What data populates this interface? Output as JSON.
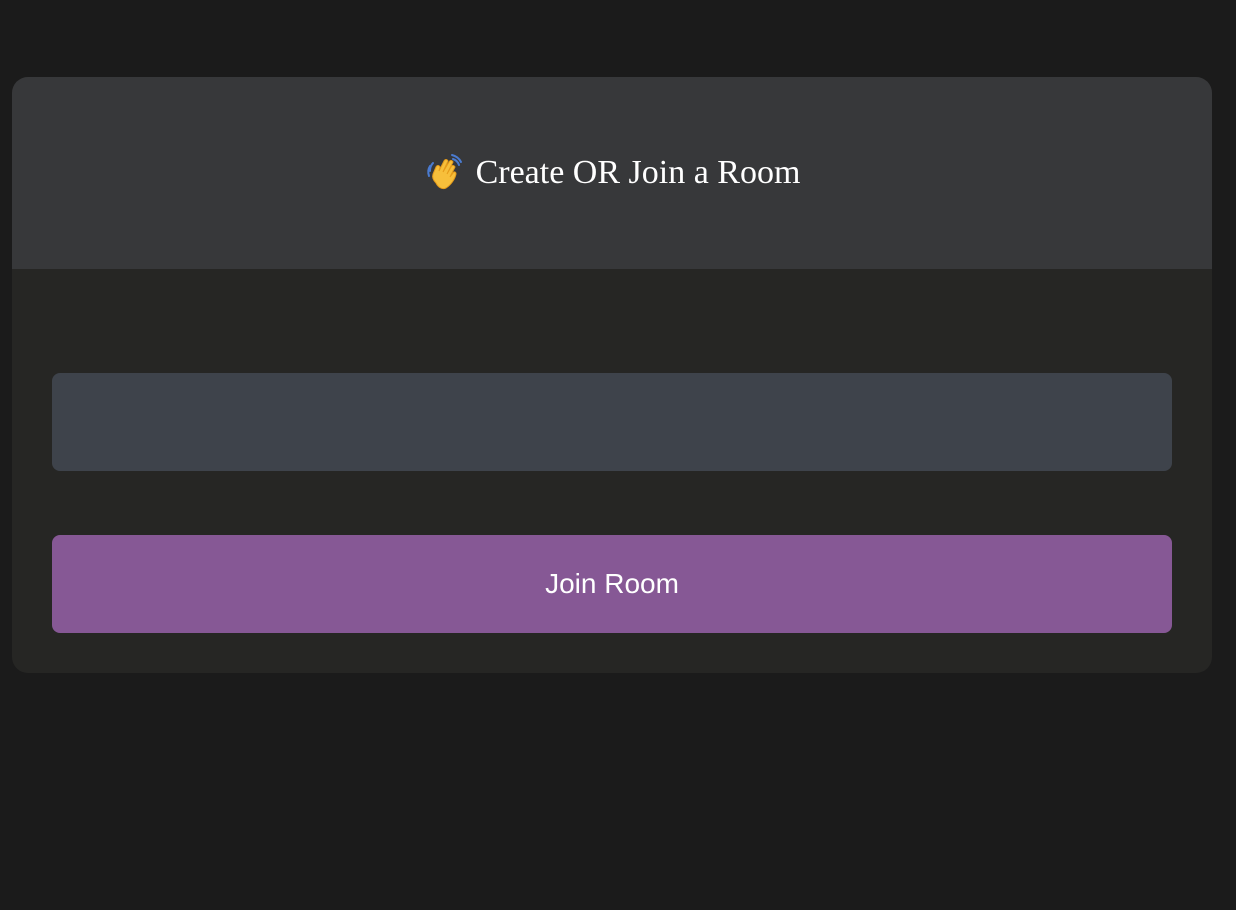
{
  "header": {
    "title_icon": "waving-hand-icon",
    "title": "Create OR Join a Room"
  },
  "form": {
    "room_input": {
      "value": "",
      "placeholder": ""
    },
    "join_label": "Join Room"
  },
  "colors": {
    "page_background": "#1b1b1b",
    "header_background": "#37383a",
    "card_background": "#262624",
    "input_background": "#3e434b",
    "button_background": "#865895",
    "text": "#ffffff"
  }
}
